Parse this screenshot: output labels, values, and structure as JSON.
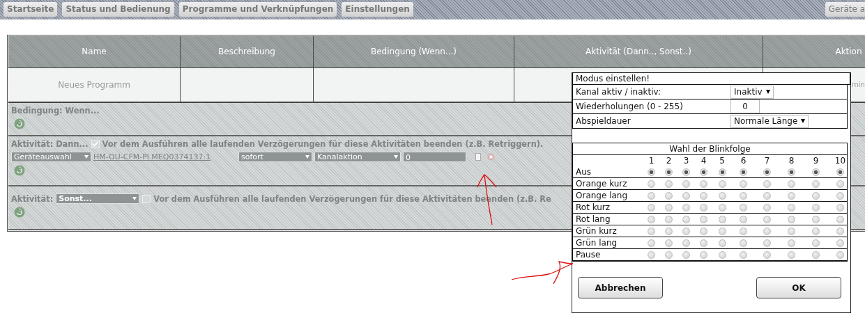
{
  "nav_tabs": [
    {
      "label": "Startseite"
    },
    {
      "label": "Status und Bedienung"
    },
    {
      "label": "Programme und Verknüpfungen"
    },
    {
      "label": "Einstellungen"
    },
    {
      "label": "Geräte a"
    }
  ],
  "table": {
    "columns": [
      "Name",
      "Beschreibung",
      "Bedingung (Wenn...)",
      "Aktivität (Dann.., Sonst..)",
      "Aktion"
    ],
    "rows": [
      {
        "name": "Neues Programm",
        "column_5": "min"
      }
    ]
  },
  "condition": {
    "label": "Bedingung: Wenn..."
  },
  "activity_then": {
    "label": "Aktivität: Dann...",
    "checkbox": {
      "checked": true,
      "label": "Vor dem Ausführen alle laufenden Verzögerungen für diese Aktivitäten beenden (z.B. Retriggern)."
    },
    "device_select": "Geräteauswahl",
    "device_link": "HM-OU-CFM-Pl MEQ0374137:1",
    "timing_select": "sofort",
    "action_select": "Kanalaktion",
    "value_field": "0"
  },
  "activity_else": {
    "label": "Aktivität:",
    "select": "Sonst...",
    "checkbox": {
      "checked": false,
      "label": "Vor dem Ausführen alle laufenden Verzögerungen für diese Aktivitäten beenden (z.B. Re"
    }
  },
  "dialog": {
    "title": "Modus einstellen!",
    "fields": [
      {
        "label": "Kanal aktiv / inaktiv:",
        "kind": "select",
        "value": "Inaktiv"
      },
      {
        "label": "Wiederholungen (0 - 255)",
        "kind": "number",
        "value": "0"
      },
      {
        "label": "Abspieldauer",
        "kind": "select",
        "value": "Normale Länge"
      }
    ],
    "blink_table": {
      "title": "Wahl der Blinkfolge",
      "steps": [
        "1",
        "2",
        "3",
        "4",
        "5",
        "6",
        "7",
        "8",
        "9",
        "10"
      ],
      "rows": [
        {
          "label": "Aus",
          "options": [
            {
              "selected": true
            },
            {
              "selected": true
            },
            {
              "selected": true
            },
            {
              "selected": true
            },
            {
              "selected": true
            },
            {
              "selected": true
            },
            {
              "selected": true
            },
            {
              "selected": true
            },
            {
              "selected": true
            },
            {
              "selected": true
            }
          ]
        },
        {
          "label": "Orange kurz",
          "options": [
            {
              "selected": false
            },
            {
              "selected": false
            },
            {
              "selected": false
            },
            {
              "selected": false
            },
            {
              "selected": false
            },
            {
              "selected": false
            },
            {
              "selected": false
            },
            {
              "selected": false
            },
            {
              "selected": false
            },
            {
              "selected": false
            }
          ]
        },
        {
          "label": "Orange lang",
          "options": [
            {
              "selected": false
            },
            {
              "selected": false
            },
            {
              "selected": false
            },
            {
              "selected": false
            },
            {
              "selected": false
            },
            {
              "selected": false
            },
            {
              "selected": false
            },
            {
              "selected": false
            },
            {
              "selected": false
            },
            {
              "selected": false
            }
          ]
        },
        {
          "label": "Rot kurz",
          "options": [
            {
              "selected": false
            },
            {
              "selected": false
            },
            {
              "selected": false
            },
            {
              "selected": false
            },
            {
              "selected": false
            },
            {
              "selected": false
            },
            {
              "selected": false
            },
            {
              "selected": false
            },
            {
              "selected": false
            },
            {
              "selected": false
            }
          ]
        },
        {
          "label": "Rot lang",
          "options": [
            {
              "selected": false
            },
            {
              "selected": false
            },
            {
              "selected": false
            },
            {
              "selected": false
            },
            {
              "selected": false
            },
            {
              "selected": false
            },
            {
              "selected": false
            },
            {
              "selected": false
            },
            {
              "selected": false
            },
            {
              "selected": false
            }
          ]
        },
        {
          "label": "Grün kurz",
          "options": [
            {
              "selected": false
            },
            {
              "selected": false
            },
            {
              "selected": false
            },
            {
              "selected": false
            },
            {
              "selected": false
            },
            {
              "selected": false
            },
            {
              "selected": false
            },
            {
              "selected": false
            },
            {
              "selected": false
            },
            {
              "selected": false
            }
          ]
        },
        {
          "label": "Grün lang",
          "options": [
            {
              "selected": false
            },
            {
              "selected": false
            },
            {
              "selected": false
            },
            {
              "selected": false
            },
            {
              "selected": false
            },
            {
              "selected": false
            },
            {
              "selected": false
            },
            {
              "selected": false
            },
            {
              "selected": false
            },
            {
              "selected": false
            }
          ]
        },
        {
          "label": "Pause",
          "options": [
            {
              "selected": false
            },
            {
              "selected": false
            },
            {
              "selected": false
            },
            {
              "selected": false
            },
            {
              "selected": false
            },
            {
              "selected": false
            },
            {
              "selected": false
            },
            {
              "selected": false
            },
            {
              "selected": false
            },
            {
              "selected": false
            }
          ]
        }
      ]
    },
    "buttons": [
      {
        "label": "Abbrechen"
      },
      {
        "label": "OK"
      }
    ]
  }
}
